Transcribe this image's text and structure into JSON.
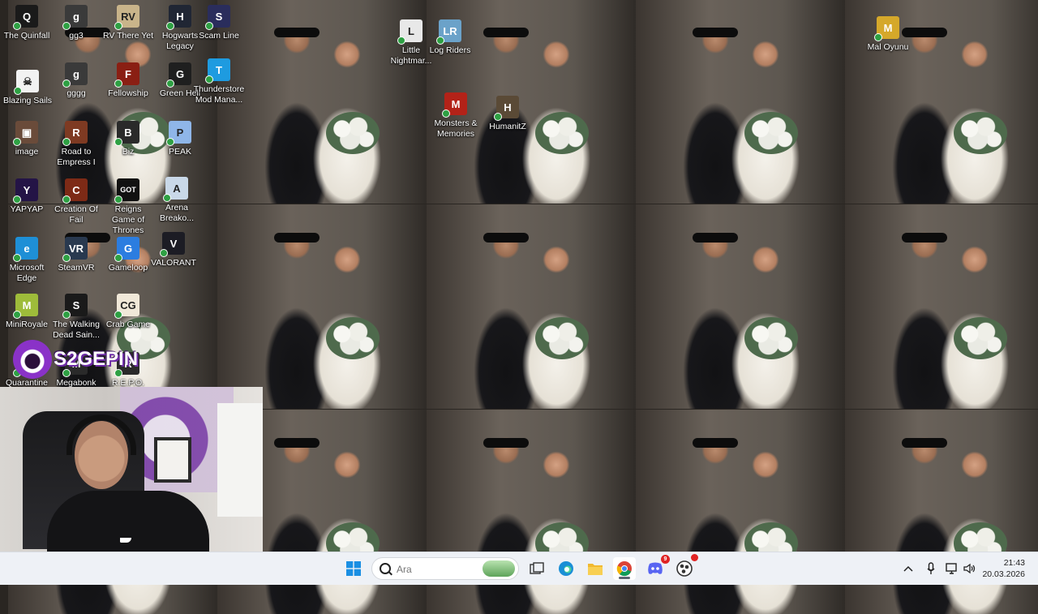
{
  "desktop": {
    "icons": [
      {
        "label": "The Quinfall",
        "icon": "game-icon",
        "color": "#1a1a1a",
        "glyph": "Q"
      },
      {
        "label": "gg3",
        "icon": "app-icon",
        "color": "#3a3a3a",
        "glyph": "g"
      },
      {
        "label": "RV There Yet",
        "icon": "game-icon",
        "color": "#c9b48a",
        "glyph": "RV"
      },
      {
        "label": "Hogwarts Legacy",
        "icon": "game-icon",
        "color": "#202634",
        "glyph": "H"
      },
      {
        "label": "Scam Line",
        "icon": "game-icon",
        "color": "#2a2d5c",
        "glyph": "S"
      },
      {
        "label": "Little Nightmar...",
        "icon": "game-icon",
        "color": "#e8e8e8",
        "glyph": "L"
      },
      {
        "label": "Log Riders",
        "icon": "game-icon",
        "color": "#6ba2c9",
        "glyph": "LR"
      },
      {
        "label": "Mal Oyunu",
        "icon": "game-icon",
        "color": "#d5a82a",
        "glyph": "M"
      },
      {
        "label": "Blazing Sails",
        "icon": "skull-icon",
        "color": "#f2f2f2",
        "glyph": "☠"
      },
      {
        "label": "gggg",
        "icon": "app-icon",
        "color": "#3a3a3a",
        "glyph": "g"
      },
      {
        "label": "Fellowship",
        "icon": "game-icon",
        "color": "#8a1f13",
        "glyph": "F"
      },
      {
        "label": "Green Hell",
        "icon": "game-icon",
        "color": "#1f1f1f",
        "glyph": "G"
      },
      {
        "label": "Thunderstore Mod Mana...",
        "icon": "game-icon",
        "color": "#1e9be0",
        "glyph": "T"
      },
      {
        "label": "Monsters & Memories",
        "icon": "game-icon",
        "color": "#b32218",
        "glyph": "M"
      },
      {
        "label": "HumanitZ",
        "icon": "game-icon",
        "color": "#5a4a36",
        "glyph": "H"
      },
      {
        "label": "image",
        "icon": "image-icon",
        "color": "#6a4b3a",
        "glyph": "▣"
      },
      {
        "label": "Road to Empress I",
        "icon": "game-icon",
        "color": "#7e3a22",
        "glyph": "R"
      },
      {
        "label": "Biz",
        "icon": "game-icon",
        "color": "#2a2a2a",
        "glyph": "B"
      },
      {
        "label": "PEAK",
        "icon": "game-icon",
        "color": "#8fb6e8",
        "glyph": "P"
      },
      {
        "label": "YAPYAP",
        "icon": "game-icon",
        "color": "#241446",
        "glyph": "Y"
      },
      {
        "label": "Creation Of Fail",
        "icon": "game-icon",
        "color": "#7d2a16",
        "glyph": "C"
      },
      {
        "label": "Reigns Game of Thrones",
        "icon": "game-icon",
        "color": "#111111",
        "glyph": "GOT"
      },
      {
        "label": "Arena Breako...",
        "icon": "game-icon",
        "color": "#c9d8e8",
        "glyph": "A"
      },
      {
        "label": "Microsoft Edge",
        "icon": "edge-icon",
        "color": "#1e8fd6",
        "glyph": "e"
      },
      {
        "label": "SteamVR",
        "icon": "steamvr-icon",
        "color": "#29394f",
        "glyph": "VR"
      },
      {
        "label": "Gameloop",
        "icon": "gameloop-icon",
        "color": "#2b7de0",
        "glyph": "G"
      },
      {
        "label": "VALORANT",
        "icon": "valorant-icon",
        "color": "#1c1c24",
        "glyph": "V"
      },
      {
        "label": "MiniRoyale",
        "icon": "game-icon",
        "color": "#9ebc3a",
        "glyph": "M"
      },
      {
        "label": "The Walking Dead Sain...",
        "icon": "game-icon",
        "color": "#1a1a1a",
        "glyph": "S"
      },
      {
        "label": "Crab Game",
        "icon": "game-icon",
        "color": "#f0e8d8",
        "glyph": "CG"
      },
      {
        "label": "Quarantine",
        "icon": "game-icon",
        "color": "#2a2a2a",
        "glyph": "Q"
      },
      {
        "label": "Megabonk",
        "icon": "game-icon",
        "color": "#2a2a2a",
        "glyph": "M"
      },
      {
        "label": "R.E.P.O.",
        "icon": "game-icon",
        "color": "#2a2a2a",
        "glyph": "R"
      }
    ]
  },
  "overlay": {
    "brand": "S2GEPIN",
    "accent": "#8a32c8"
  },
  "taskbar": {
    "search_placeholder": "Ara",
    "apps": [
      "start-icon",
      "task-view-icon",
      "edge-icon",
      "file-explorer-icon",
      "chrome-icon",
      "discord-icon",
      "obs-icon"
    ],
    "discord_badge": "9",
    "tray": {
      "time": "21:43",
      "date": "20.03.2026"
    }
  }
}
